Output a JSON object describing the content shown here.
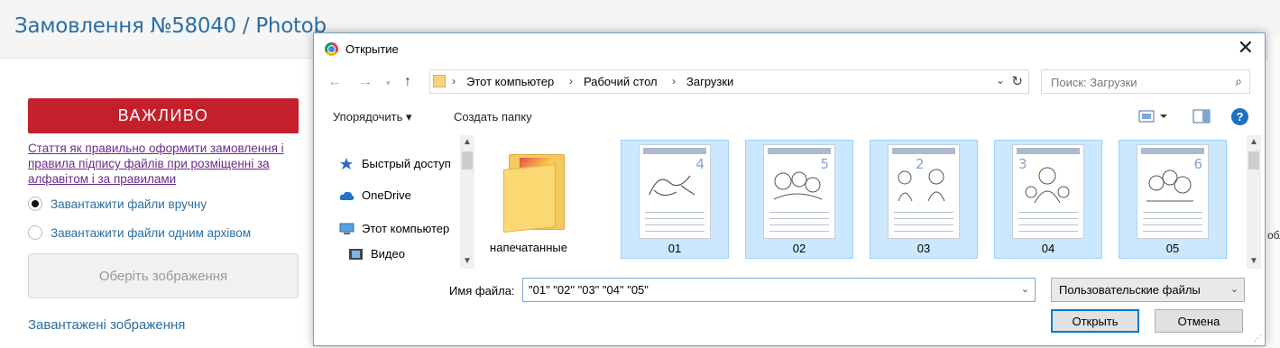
{
  "page": {
    "order_title": "Замовлення №58040 / Photob",
    "important_button": "ВАЖЛИВО",
    "article_link": "Стаття як правильно оформити замовлення і правила підпису файлів при розміщенні за алфавітом і за правилами",
    "radio_manual": "Завантажити файли вручну",
    "radio_archive": "Завантажити файли одним архівом",
    "choose_images_button": "Оберіть зображення",
    "uploaded_images_link": "Завантажені зображення",
    "right_edge_text": "обл"
  },
  "dialog": {
    "title": "Открытие",
    "breadcrumbs": [
      "Этот компьютер",
      "Рабочий стол",
      "Загрузки"
    ],
    "search_placeholder": "Поиск: Загрузки",
    "toolbar": {
      "organize": "Упорядочить ▾",
      "new_folder": "Создать папку"
    },
    "nav_items": [
      "Быстрый доступ",
      "OneDrive",
      "Этот компьютер",
      "Видео"
    ],
    "folder_name": "напечатанные",
    "files": [
      {
        "name": "01",
        "digit": "4"
      },
      {
        "name": "02",
        "digit": "5"
      },
      {
        "name": "03",
        "digit": "2"
      },
      {
        "name": "04",
        "digit": "3"
      },
      {
        "name": "05",
        "digit": "6"
      }
    ],
    "filename_label": "Имя файла:",
    "filename_value": "\"01\" \"02\" \"03\" \"04\" \"05\"",
    "filetype_value": "Пользовательские файлы",
    "open_button": "Открыть",
    "cancel_button": "Отмена"
  },
  "colors": {
    "accent": "#2a6fa5",
    "important": "#c4202c",
    "selection": "#cce8ff"
  }
}
